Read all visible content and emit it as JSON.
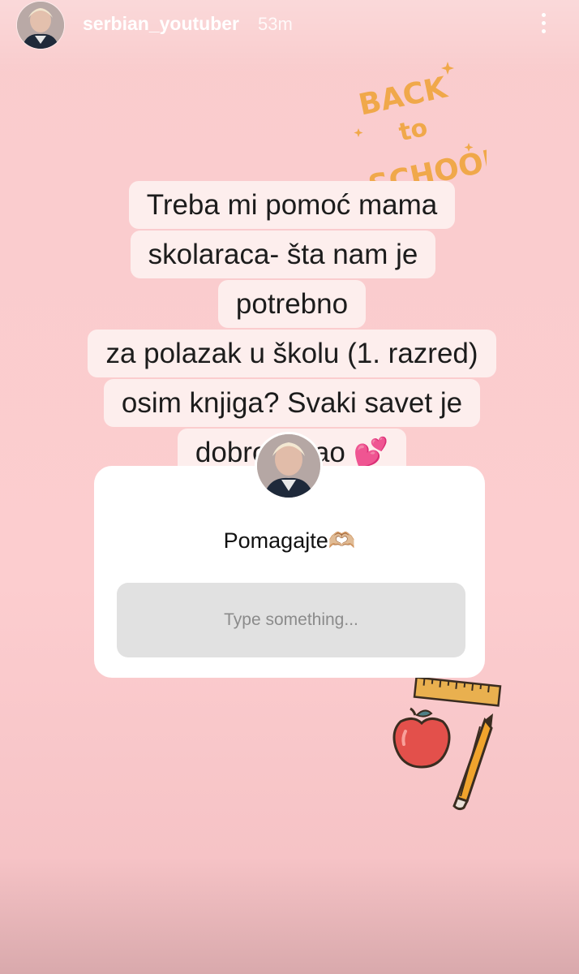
{
  "header": {
    "username": "serbian_youtuber",
    "time_ago": "53m"
  },
  "sticker": {
    "back_to_school": [
      "BACK",
      "to",
      "SCHOOL"
    ]
  },
  "question": {
    "lines": [
      "Treba mi pomoć mama",
      "skolaraca- šta nam je potrebno",
      "za polazak u školu (1. razred)",
      "osim knjiga? Svaki savet je",
      "dobrodosao 💕"
    ]
  },
  "question_box": {
    "title": "Pomagajte🫶🏼",
    "input_placeholder": "Type something..."
  },
  "colors": {
    "background": "#fccdcf",
    "text_highlight": "#fdeeed",
    "sticker_orange": "#f0a84a"
  }
}
